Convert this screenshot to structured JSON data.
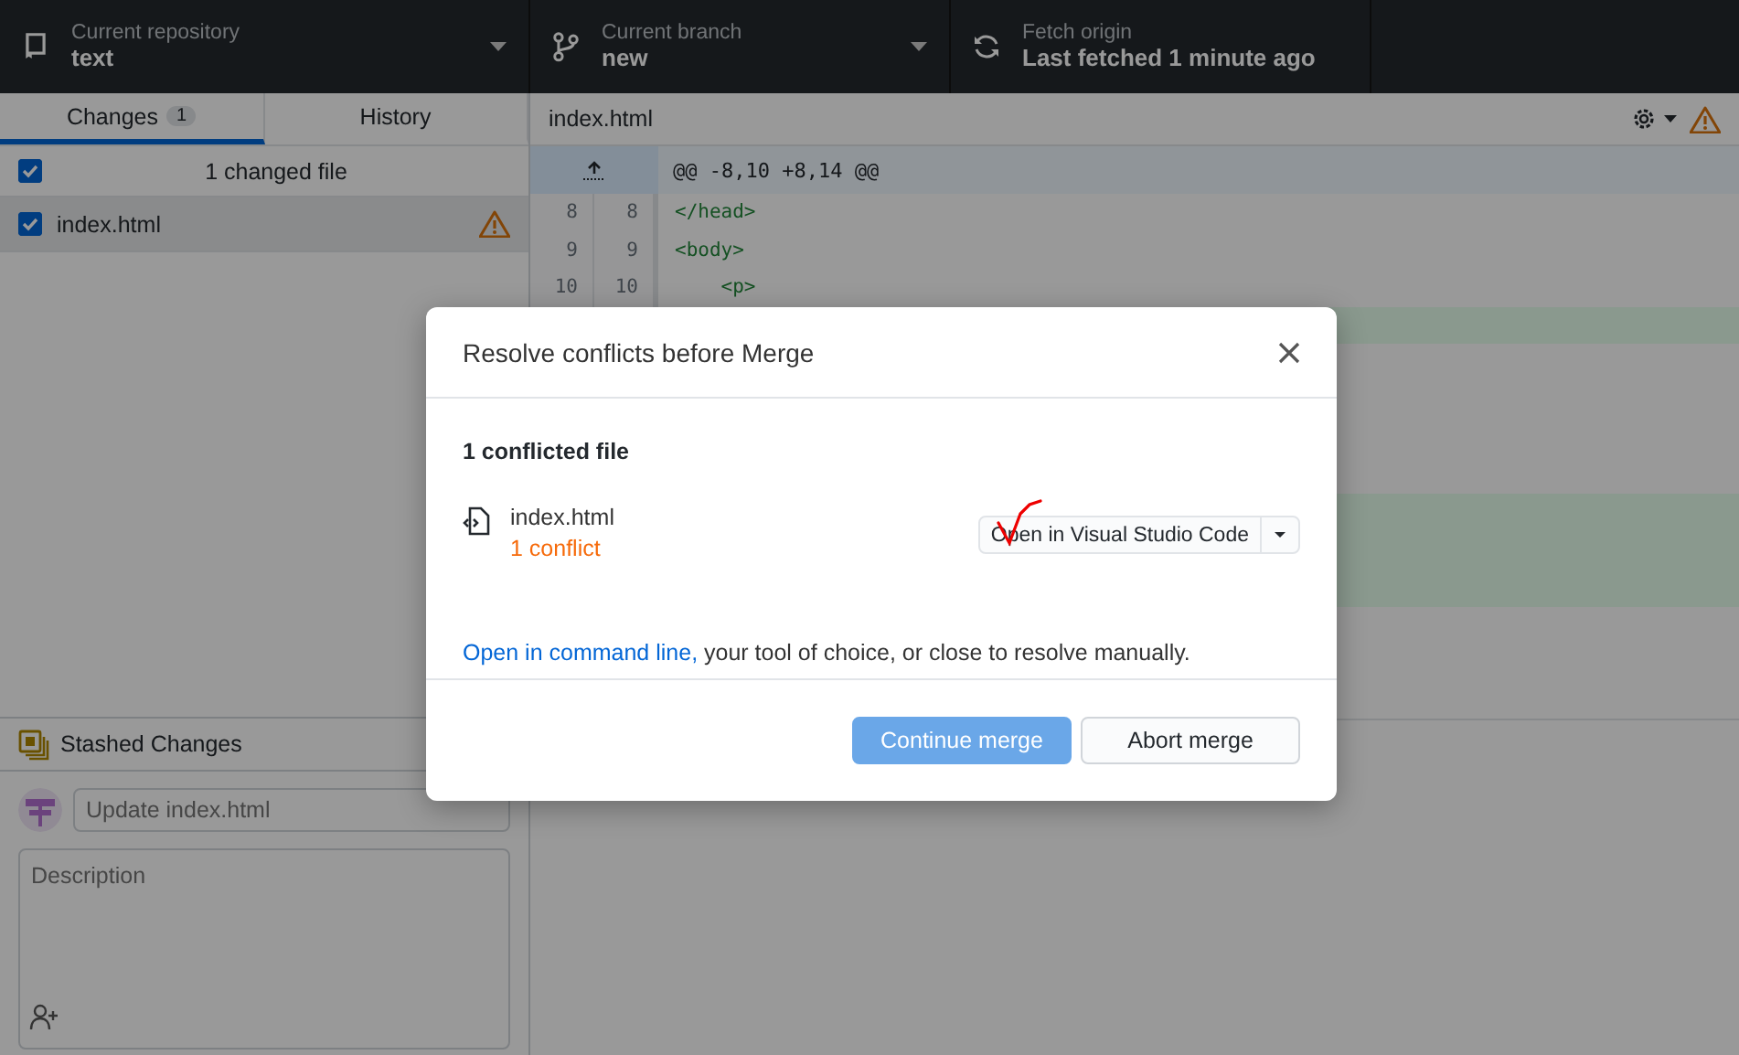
{
  "toolbar": [
    {
      "kind": "repository",
      "label": "Current repository",
      "value": "text"
    },
    {
      "kind": "branch",
      "label": "Current branch",
      "value": "new"
    },
    {
      "kind": "fetch",
      "label": "Fetch origin",
      "value": "Last fetched 1 minute ago"
    }
  ],
  "tabs": [
    {
      "label": "Changes",
      "count": "1",
      "selected": true
    },
    {
      "label": "History",
      "selected": false
    }
  ],
  "changes": {
    "header": "1 changed file",
    "all_checked": true,
    "files": [
      {
        "name": "index.html",
        "checked": true,
        "selected": true,
        "conflict": true
      }
    ]
  },
  "stash": {
    "label": "Stashed Changes"
  },
  "commit": {
    "summary_placeholder": "Update index.html",
    "description_placeholder": "Description"
  },
  "diff": {
    "file": "index.html",
    "hunk": "@@ -8,10 +8,14 @@",
    "lines": [
      {
        "kind": "context",
        "old": "8",
        "new": "8",
        "code": "</head>"
      },
      {
        "kind": "context",
        "old": "9",
        "new": "9",
        "code": "<body>"
      },
      {
        "kind": "context",
        "old": "10",
        "new": "10",
        "code": "    <p>"
      },
      {
        "kind": "added"
      },
      {
        "kind": "context"
      },
      {
        "kind": "context"
      },
      {
        "kind": "context"
      },
      {
        "kind": "context"
      },
      {
        "kind": "added"
      },
      {
        "kind": "added"
      },
      {
        "kind": "added"
      },
      {
        "kind": "context"
      },
      {
        "kind": "context"
      },
      {
        "kind": "context"
      }
    ]
  },
  "dialog": {
    "title": "Resolve conflicts before Merge",
    "heading": "1 conflicted file",
    "files": [
      {
        "name": "index.html",
        "status": "1 conflict",
        "action": "Open in Visual Studio Code"
      }
    ],
    "note_link": "Open in command line,",
    "note_text": "your tool of choice, or close to resolve manually.",
    "buttons": [
      {
        "label": "Continue merge",
        "primary": true
      },
      {
        "label": "Abort merge",
        "primary": false
      }
    ]
  }
}
